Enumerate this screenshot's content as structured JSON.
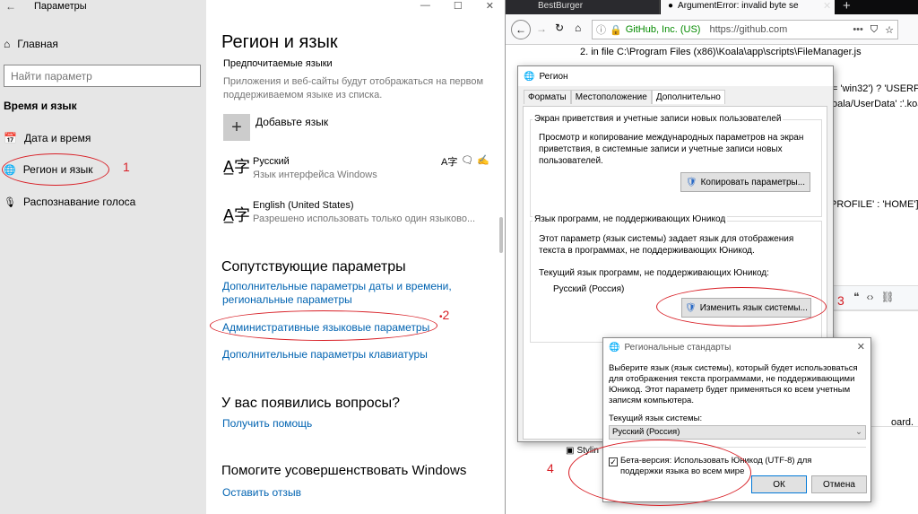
{
  "settings": {
    "window_title": "Параметры",
    "home": "Главная",
    "search_placeholder": "Найти параметр",
    "category": "Время и язык",
    "nav": [
      "Дата и время",
      "Регион и язык",
      "Распознавание голоса"
    ],
    "page_title": "Регион и язык",
    "preferred_heading": "Предпочитаемые языки",
    "preferred_desc": "Приложения и веб-сайты будут отображаться на первом поддерживаемом языке из списка.",
    "add_language": "Добавьте язык",
    "languages": [
      {
        "name": "Русский",
        "desc": "Язык интерфейса Windows"
      },
      {
        "name": "English (United States)",
        "desc": "Разрешено использовать только один языково..."
      }
    ],
    "related_heading": "Сопутствующие параметры",
    "related_links": [
      "Дополнительные параметры даты и времени, региональные параметры",
      "Административные языковые параметры",
      "Дополнительные параметры клавиатуры"
    ],
    "questions_heading": "У вас появились вопросы?",
    "questions_link": "Получить помощь",
    "improve_heading": "Помогите усовершенствовать Windows",
    "improve_link": "Оставить отзыв"
  },
  "browser": {
    "tabs": [
      "BestBurger",
      "ArgumentError: invalid byte se"
    ],
    "cert": "GitHub, Inc. (US)",
    "url": "https://github.com",
    "content_line": "2. in file C:\\Program Files (x86)\\Koala\\app\\scripts\\FileManager.js",
    "snippets": [
      "= 'win32') ? 'USERP",
      "oala/UserData' :'.koa",
      "PROFILE' : 'HOME']",
      "oard.",
      "Stylin"
    ]
  },
  "region_dialog": {
    "title": "Регион",
    "tabs": [
      "Форматы",
      "Местоположение",
      "Дополнительно"
    ],
    "group1_title": "Экран приветствия и учетные записи новых пользователей",
    "group1_text": "Просмотр и копирование международных параметров на экран приветствия, в системные записи и учетные записи новых пользователей.",
    "copy_button": "Копировать параметры...",
    "group2_title": "Язык программ, не поддерживающих Юникод",
    "group2_text": "Этот параметр (язык системы) задает язык для отображения текста в программах, не поддерживающих Юникод.",
    "current_label": "Текущий язык программ, не поддерживающих Юникод:",
    "current_value": "Русский (Россия)",
    "change_button": "Изменить язык системы..."
  },
  "regional_dialog": {
    "title": "Региональные стандарты",
    "description": "Выберите язык (язык системы), который будет использоваться для отображения текста программами, не поддерживающими Юникод. Этот параметр будет применяться ко всем учетным записям компьютера.",
    "current_label": "Текущий язык системы:",
    "current_value": "Русский (Россия)",
    "beta_checkbox": "Бета-версия: Использовать Юникод (UTF-8) для поддержки языка во всем мире",
    "beta_checked": true,
    "ok": "ОК",
    "cancel": "Отмена"
  },
  "annotations": [
    "1",
    "2",
    "3",
    "4"
  ],
  "colors": {
    "accent_link": "#0063b1",
    "annotation_red": "#d81f26",
    "settings_sidebar": "#e6e6e6"
  }
}
